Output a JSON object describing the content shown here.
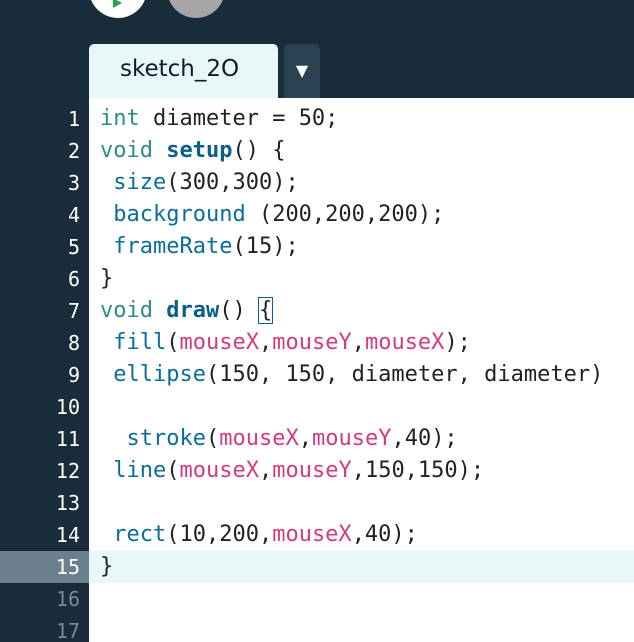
{
  "tab": {
    "name": "sketch_2O",
    "menu_icon": "▼"
  },
  "line_numbers": [
    "1",
    "2",
    "3",
    "4",
    "5",
    "6",
    "7",
    "8",
    "9",
    "10",
    "11",
    "12",
    "13",
    "14",
    "15",
    "16",
    "17"
  ],
  "active_line": 15,
  "code": [
    [
      {
        "t": "type",
        "v": "int"
      },
      {
        "t": "plain",
        "v": " diameter = 50;"
      }
    ],
    [
      {
        "t": "type",
        "v": "void"
      },
      {
        "t": "plain",
        "v": " "
      },
      {
        "t": "fnbold",
        "v": "setup"
      },
      {
        "t": "plain",
        "v": "() {"
      }
    ],
    [
      {
        "t": "plain",
        "v": " "
      },
      {
        "t": "fn",
        "v": "size"
      },
      {
        "t": "plain",
        "v": "(300,300);"
      }
    ],
    [
      {
        "t": "plain",
        "v": " "
      },
      {
        "t": "fn",
        "v": "background"
      },
      {
        "t": "plain",
        "v": " (200,200,200);"
      }
    ],
    [
      {
        "t": "plain",
        "v": " "
      },
      {
        "t": "fn",
        "v": "frameRate"
      },
      {
        "t": "plain",
        "v": "(15);"
      }
    ],
    [
      {
        "t": "plain",
        "v": "}"
      }
    ],
    [
      {
        "t": "type",
        "v": "void"
      },
      {
        "t": "plain",
        "v": " "
      },
      {
        "t": "fnbold",
        "v": "draw"
      },
      {
        "t": "plain",
        "v": "() "
      },
      {
        "t": "bracket",
        "v": "{"
      }
    ],
    [
      {
        "t": "plain",
        "v": " "
      },
      {
        "t": "fn",
        "v": "fill"
      },
      {
        "t": "plain",
        "v": "("
      },
      {
        "t": "var",
        "v": "mouseX"
      },
      {
        "t": "plain",
        "v": ","
      },
      {
        "t": "var",
        "v": "mouseY"
      },
      {
        "t": "plain",
        "v": ","
      },
      {
        "t": "var",
        "v": "mouseX"
      },
      {
        "t": "plain",
        "v": ");"
      }
    ],
    [
      {
        "t": "plain",
        "v": " "
      },
      {
        "t": "fn",
        "v": "ellipse"
      },
      {
        "t": "plain",
        "v": "(150, 150, diameter, diameter)"
      }
    ],
    [],
    [
      {
        "t": "plain",
        "v": "  "
      },
      {
        "t": "fn",
        "v": "stroke"
      },
      {
        "t": "plain",
        "v": "("
      },
      {
        "t": "var",
        "v": "mouseX"
      },
      {
        "t": "plain",
        "v": ","
      },
      {
        "t": "var",
        "v": "mouseY"
      },
      {
        "t": "plain",
        "v": ",40);"
      }
    ],
    [
      {
        "t": "plain",
        "v": " "
      },
      {
        "t": "fn",
        "v": "line"
      },
      {
        "t": "plain",
        "v": "("
      },
      {
        "t": "var",
        "v": "mouseX"
      },
      {
        "t": "plain",
        "v": ","
      },
      {
        "t": "var",
        "v": "mouseY"
      },
      {
        "t": "plain",
        "v": ",150,150);"
      }
    ],
    [],
    [
      {
        "t": "plain",
        "v": " "
      },
      {
        "t": "fn",
        "v": "rect"
      },
      {
        "t": "plain",
        "v": "(10,200,"
      },
      {
        "t": "var",
        "v": "mouseX"
      },
      {
        "t": "plain",
        "v": ",40);"
      }
    ],
    [
      {
        "t": "plain",
        "v": "}"
      }
    ],
    [],
    []
  ]
}
